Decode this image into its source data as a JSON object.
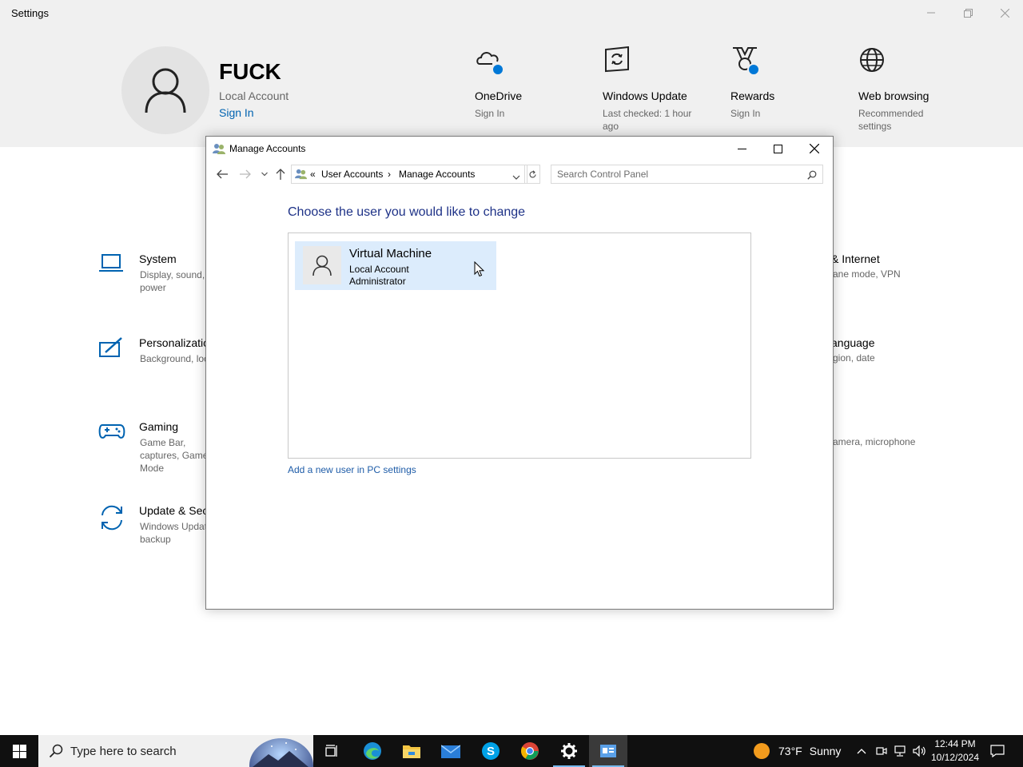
{
  "settings": {
    "title": "Settings",
    "user": {
      "name": "FUCK",
      "account_type": "Local Account",
      "sign_in": "Sign In"
    },
    "quick_tiles": [
      {
        "title": "OneDrive",
        "subtitle": "Sign In",
        "icon": "cloud-icon"
      },
      {
        "title": "Windows Update",
        "subtitle": "Last checked: 1 hour ago",
        "icon": "refresh-window-icon"
      },
      {
        "title": "Rewards",
        "subtitle": "Sign In",
        "icon": "trophy-icon"
      },
      {
        "title": "Web browsing",
        "subtitle": "Recommended settings",
        "icon": "globe-icon"
      }
    ],
    "categories": [
      {
        "title": "System",
        "subtitle": "Display, sound, power",
        "icon": "laptop-icon"
      },
      {
        "title": "Personalization",
        "subtitle": "Background, lock",
        "icon": "pen-screen-icon"
      },
      {
        "title": "Gaming",
        "subtitle": "Game Bar, captures, Game Mode",
        "icon": "gamepad-icon"
      },
      {
        "title": "Update & Security",
        "subtitle": "Windows Update, backup",
        "icon": "sync-icon"
      }
    ],
    "right_categories": [
      {
        "title": "& Internet",
        "subtitle": "ane mode, VPN"
      },
      {
        "title": "anguage",
        "subtitle": "gion, date"
      },
      {
        "title": "",
        "subtitle": "amera, microphone"
      }
    ]
  },
  "dialog": {
    "title": "Manage Accounts",
    "breadcrumb": {
      "prefix": "«",
      "parent": "User Accounts",
      "separator": "›",
      "current": "Manage Accounts"
    },
    "search_placeholder": "Search Control Panel",
    "heading": "Choose the user you would like to change",
    "accounts": [
      {
        "name": "Virtual Machine",
        "type": "Local Account",
        "role": "Administrator"
      }
    ],
    "add_user_link": "Add a new user in PC settings"
  },
  "taskbar": {
    "search_placeholder": "Type here to search",
    "weather": {
      "temp": "73°F",
      "condition": "Sunny"
    },
    "clock": {
      "time": "12:44 PM",
      "date": "10/12/2024"
    },
    "apps": [
      "task-view-icon",
      "edge-icon",
      "file-explorer-icon",
      "mail-icon",
      "skype-icon",
      "chrome-icon",
      "settings-icon",
      "control-panel-icon"
    ]
  },
  "colors": {
    "accent": "#0078d7",
    "link": "#0063b1",
    "heading": "#1e3287",
    "selection": "#dcecfc"
  }
}
